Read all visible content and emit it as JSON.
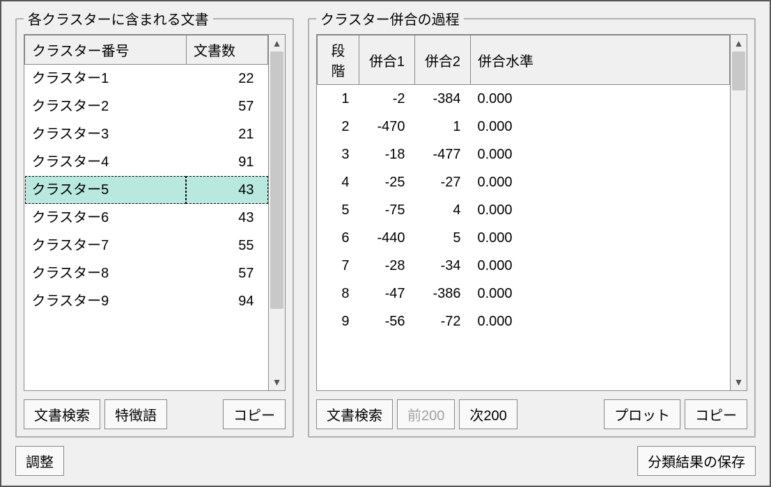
{
  "left_panel": {
    "title": "各クラスターに含まれる文書",
    "headers": {
      "cluster_no": "クラスター番号",
      "doc_count": "文書数"
    },
    "rows": [
      {
        "name": "クラスター1",
        "count": 22,
        "selected": false
      },
      {
        "name": "クラスター2",
        "count": 57,
        "selected": false
      },
      {
        "name": "クラスター3",
        "count": 21,
        "selected": false
      },
      {
        "name": "クラスター4",
        "count": 91,
        "selected": false
      },
      {
        "name": "クラスター5",
        "count": 43,
        "selected": true
      },
      {
        "name": "クラスター6",
        "count": 43,
        "selected": false
      },
      {
        "name": "クラスター7",
        "count": 55,
        "selected": false
      },
      {
        "name": "クラスター8",
        "count": 57,
        "selected": false
      },
      {
        "name": "クラスター9",
        "count": 94,
        "selected": false
      }
    ],
    "buttons": {
      "doc_search": "文書検索",
      "feature_words": "特徴語",
      "copy": "コピー"
    }
  },
  "right_panel": {
    "title": "クラスター併合の過程",
    "headers": {
      "stage": "段階",
      "merge1": "併合1",
      "merge2": "併合2",
      "merge_level": "併合水準"
    },
    "rows": [
      {
        "stage": 1,
        "m1": -2,
        "m2": -384,
        "level": "0.000"
      },
      {
        "stage": 2,
        "m1": -470,
        "m2": 1,
        "level": "0.000"
      },
      {
        "stage": 3,
        "m1": -18,
        "m2": -477,
        "level": "0.000"
      },
      {
        "stage": 4,
        "m1": -25,
        "m2": -27,
        "level": "0.000"
      },
      {
        "stage": 5,
        "m1": -75,
        "m2": 4,
        "level": "0.000"
      },
      {
        "stage": 6,
        "m1": -440,
        "m2": 5,
        "level": "0.000"
      },
      {
        "stage": 7,
        "m1": -28,
        "m2": -34,
        "level": "0.000"
      },
      {
        "stage": 8,
        "m1": -47,
        "m2": -386,
        "level": "0.000"
      },
      {
        "stage": 9,
        "m1": -56,
        "m2": -72,
        "level": "0.000"
      }
    ],
    "buttons": {
      "doc_search": "文書検索",
      "prev200": "前200",
      "next200": "次200",
      "plot": "プロット",
      "copy": "コピー"
    }
  },
  "bottom": {
    "adjust": "調整",
    "save_results": "分類結果の保存"
  }
}
